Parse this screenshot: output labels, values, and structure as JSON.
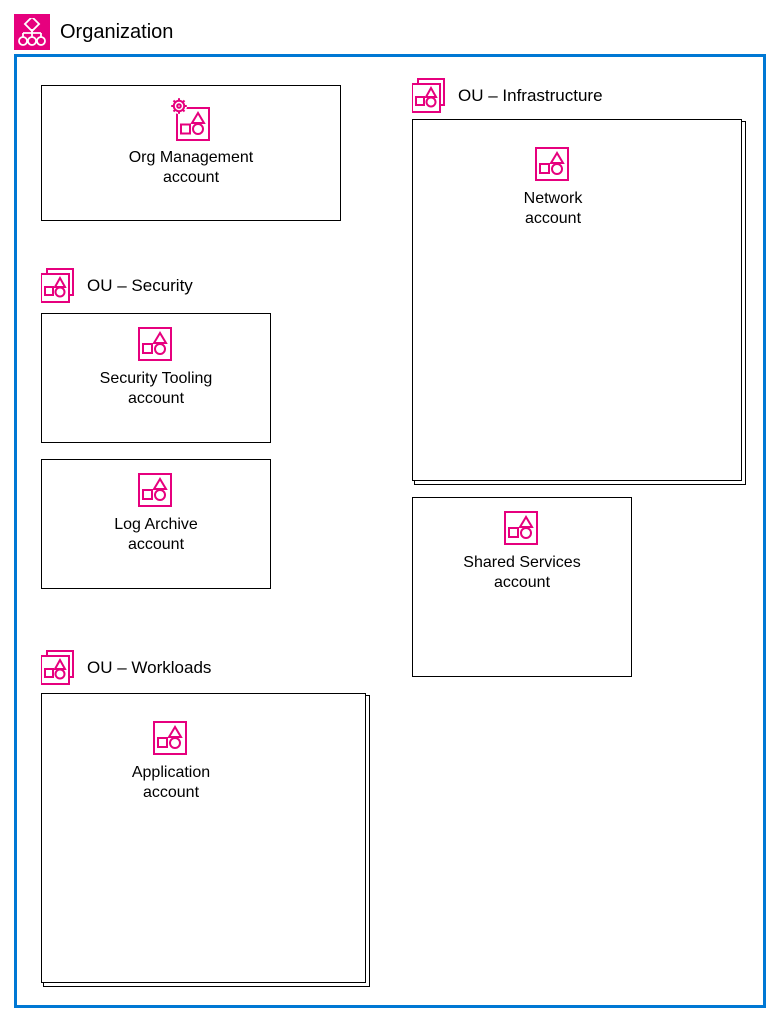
{
  "organization": {
    "title": "Organization"
  },
  "accounts": {
    "org_management": "Org Management\naccount",
    "network": "Network\naccount",
    "security_tooling": "Security Tooling\naccount",
    "log_archive": "Log Archive\naccount",
    "shared_services": "Shared Services\naccount",
    "application": "Application\naccount"
  },
  "ous": {
    "security": "OU – Security",
    "infrastructure": "OU – Infrastructure",
    "workloads": "OU – Workloads"
  },
  "colors": {
    "brand_pink": "#e6007e",
    "brand_blue": "#0078d4"
  }
}
